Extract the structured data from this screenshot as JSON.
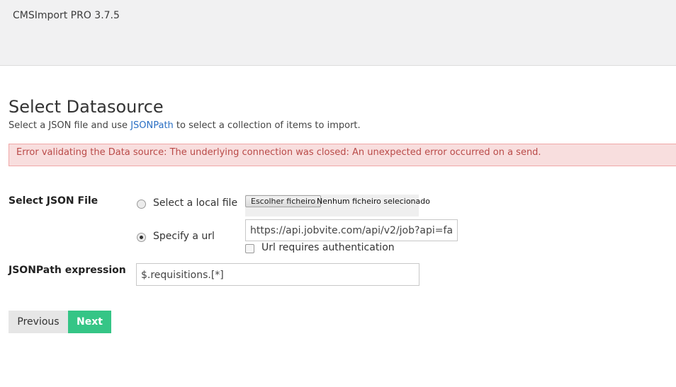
{
  "header": {
    "app_title": "CMSImport PRO 3.7.5"
  },
  "main": {
    "title": "Select Datasource",
    "subtitle_before": "Select a JSON file and use ",
    "subtitle_link": "JSONPath",
    "subtitle_after": " to select a collection of items to import.",
    "error": "Error validating the Data source: The underlying connection was closed: An unexpected error occurred on a send."
  },
  "form": {
    "select_json_label": "Select JSON File",
    "local_file_option": "Select a local file",
    "file_button": "Escolher ficheiro",
    "file_status": "Nenhum ficheiro selecionado",
    "url_option": "Specify a url",
    "url_value": "https://api.jobvite.com/api/v2/job?api=fa",
    "url_auth_label": "Url requires authentication",
    "url_auth_checked": false,
    "selected_option": "url",
    "jsonpath_label": "JSONPath expression",
    "jsonpath_value": "$.requisitions.[*]"
  },
  "buttons": {
    "previous": "Previous",
    "next": "Next"
  },
  "colors": {
    "next_button": "#35c586",
    "error_background": "#f8dede",
    "error_text": "#b94a48",
    "link": "#2a6fc4"
  }
}
